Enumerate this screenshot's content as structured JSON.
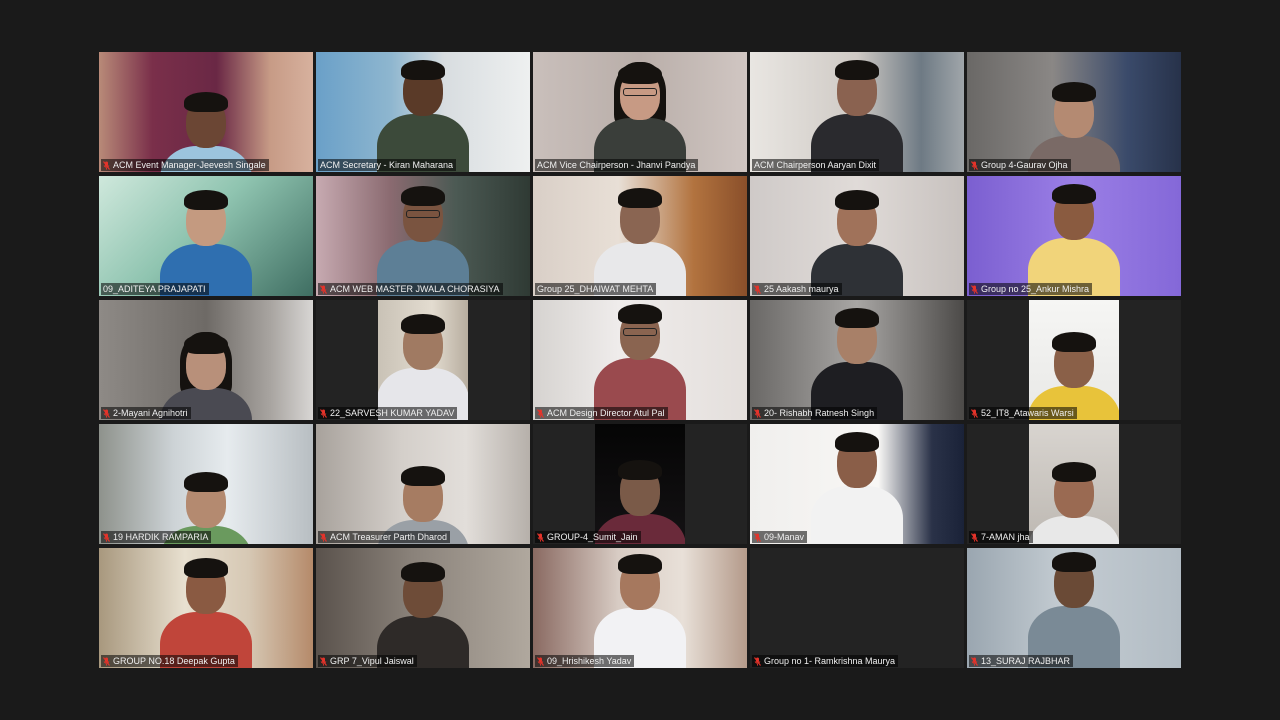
{
  "participants": [
    {
      "name": "ACM Event Manager-Jeevesh Singale",
      "muted": true
    },
    {
      "name": "ACM Secretary - Kiran Maharana",
      "muted": false
    },
    {
      "name": "ACM Vice Chairperson - Jhanvi Pandya",
      "muted": false
    },
    {
      "name": "ACM Chairperson Aaryan Dixit",
      "muted": false
    },
    {
      "name": "Group 4-Gaurav Ojha",
      "muted": true
    },
    {
      "name": "09_ADITEYA PRAJAPATI",
      "muted": false
    },
    {
      "name": "ACM WEB MASTER JWALA CHORASIYA",
      "muted": true
    },
    {
      "name": "Group 25_DHAIWAT MEHTA",
      "muted": false
    },
    {
      "name": "25 Aakash maurya",
      "muted": true
    },
    {
      "name": "Group no 25_Ankur Mishra",
      "muted": true
    },
    {
      "name": "2-Mayani Agnihotri",
      "muted": true
    },
    {
      "name": "22_SARVESH KUMAR YADAV",
      "muted": true
    },
    {
      "name": "ACM Design Director Atul Pal",
      "muted": true
    },
    {
      "name": "20- Rishabh Ratnesh Singh",
      "muted": true
    },
    {
      "name": "52_IT8_Atawaris Warsi",
      "muted": true
    },
    {
      "name": "19 HARDIK RAMPARIA",
      "muted": true
    },
    {
      "name": "ACM Treasurer Parth Dharod",
      "muted": true
    },
    {
      "name": "GROUP-4_Sumit_Jain",
      "muted": true
    },
    {
      "name": "09-Manav",
      "muted": true
    },
    {
      "name": "7-AMAN jha",
      "muted": true
    },
    {
      "name": "GROUP NO.18  Deepak Gupta",
      "muted": true
    },
    {
      "name": "GRP 7_Vipul Jaiswal",
      "muted": true
    },
    {
      "name": "09_Hrishikesh Yadav",
      "muted": true
    },
    {
      "name": "Group no 1- Ramkrishna Maurya",
      "muted": true
    },
    {
      "name": "13_SURAJ RAJBHAR",
      "muted": true
    }
  ],
  "active_speaker_index": 9,
  "colors": {
    "background": "#1a1a1a",
    "active_border": "#e6e26a",
    "muted_icon": "#e5332a",
    "label_text": "#f0f0f0"
  }
}
